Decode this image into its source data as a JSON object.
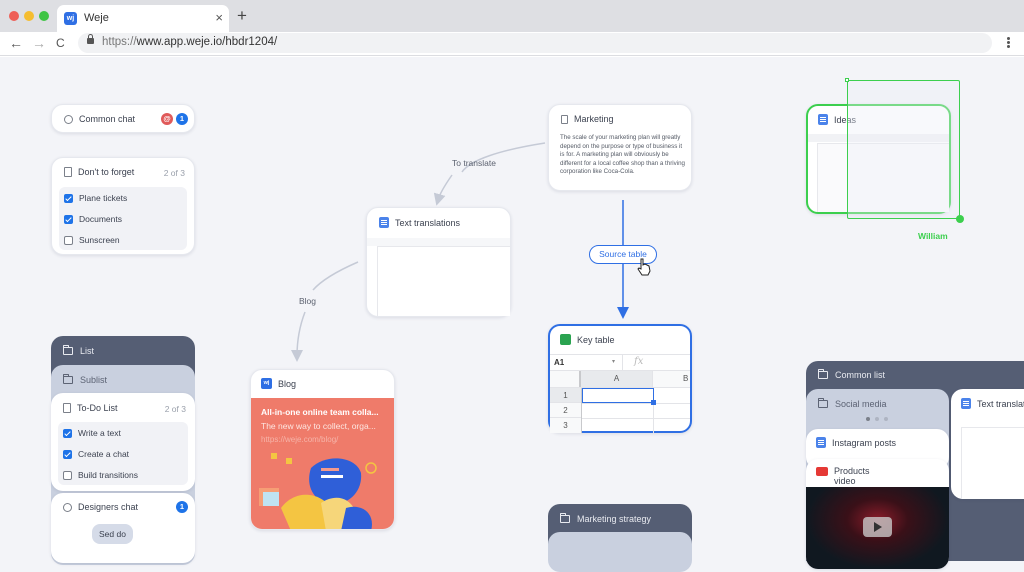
{
  "browser": {
    "tab_title": "Weje",
    "tab_logo": "wj",
    "url_scheme": "https://",
    "url_rest": "www.app.weje.io/hbdr1204/",
    "icons": [
      "back-icon",
      "forward-icon",
      "reload-icon",
      "lock-icon",
      "menu-icon",
      "close-icon",
      "new-tab-icon"
    ],
    "close": "×",
    "new_tab": "+",
    "back": "←",
    "forward": "→",
    "reload": "C"
  },
  "colors": {
    "accent": "#1e73e8",
    "mention": "#e05a5a",
    "cursor_green": "#3ccf4e",
    "dark_panel": "#555e74",
    "blog_bg": "#ef7b6a"
  },
  "common_chat": {
    "title": "Common chat",
    "mention_badge": "@",
    "unread": "1"
  },
  "dont_forget": {
    "title": "Don't to forget",
    "count": "2 of 3",
    "items": [
      {
        "label": "Plane tickets",
        "checked": true
      },
      {
        "label": "Documents",
        "checked": true
      },
      {
        "label": "Sunscreen",
        "checked": false
      }
    ]
  },
  "marketing": {
    "title": "Marketing",
    "body": "The scale of your marketing plan will greatly depend on the purpose or type of business it is for. A marketing plan will obviously be different for a local coffee shop than a thriving corporation like Coca-Cola."
  },
  "edges": {
    "to_translate": "To translate",
    "blog": "Blog",
    "source_table": "Source table"
  },
  "text_translations": {
    "title": "Text translations"
  },
  "ideas": {
    "title": "Ideas",
    "collaborator": "William"
  },
  "key_table": {
    "title": "Key table",
    "cell_ref": "A1",
    "fx": "fx",
    "columns": [
      "A",
      "B"
    ],
    "rows": [
      "1",
      "2",
      "3"
    ]
  },
  "blog": {
    "title": "Blog",
    "headline": "All-in-one online team colla...",
    "subline": "The new way to collect, orga...",
    "link": "https://weje.com/blog/"
  },
  "list": {
    "title": "List",
    "sublist": "Sublist",
    "todo": {
      "title": "To-Do List",
      "count": "2 of 3",
      "items": [
        {
          "label": "Write a text",
          "checked": true
        },
        {
          "label": "Create a chat",
          "checked": true
        },
        {
          "label": "Build transitions",
          "checked": false
        }
      ]
    },
    "designers_chat": {
      "title": "Designers chat",
      "unread": "1",
      "message": "Sed do"
    }
  },
  "marketing_strategy": {
    "title": "Marketing strategy"
  },
  "common_list": {
    "title": "Common list",
    "social_media": "Social media",
    "instagram": "Instagram posts",
    "products_video": "Products video",
    "text_translations": "Text translat"
  }
}
